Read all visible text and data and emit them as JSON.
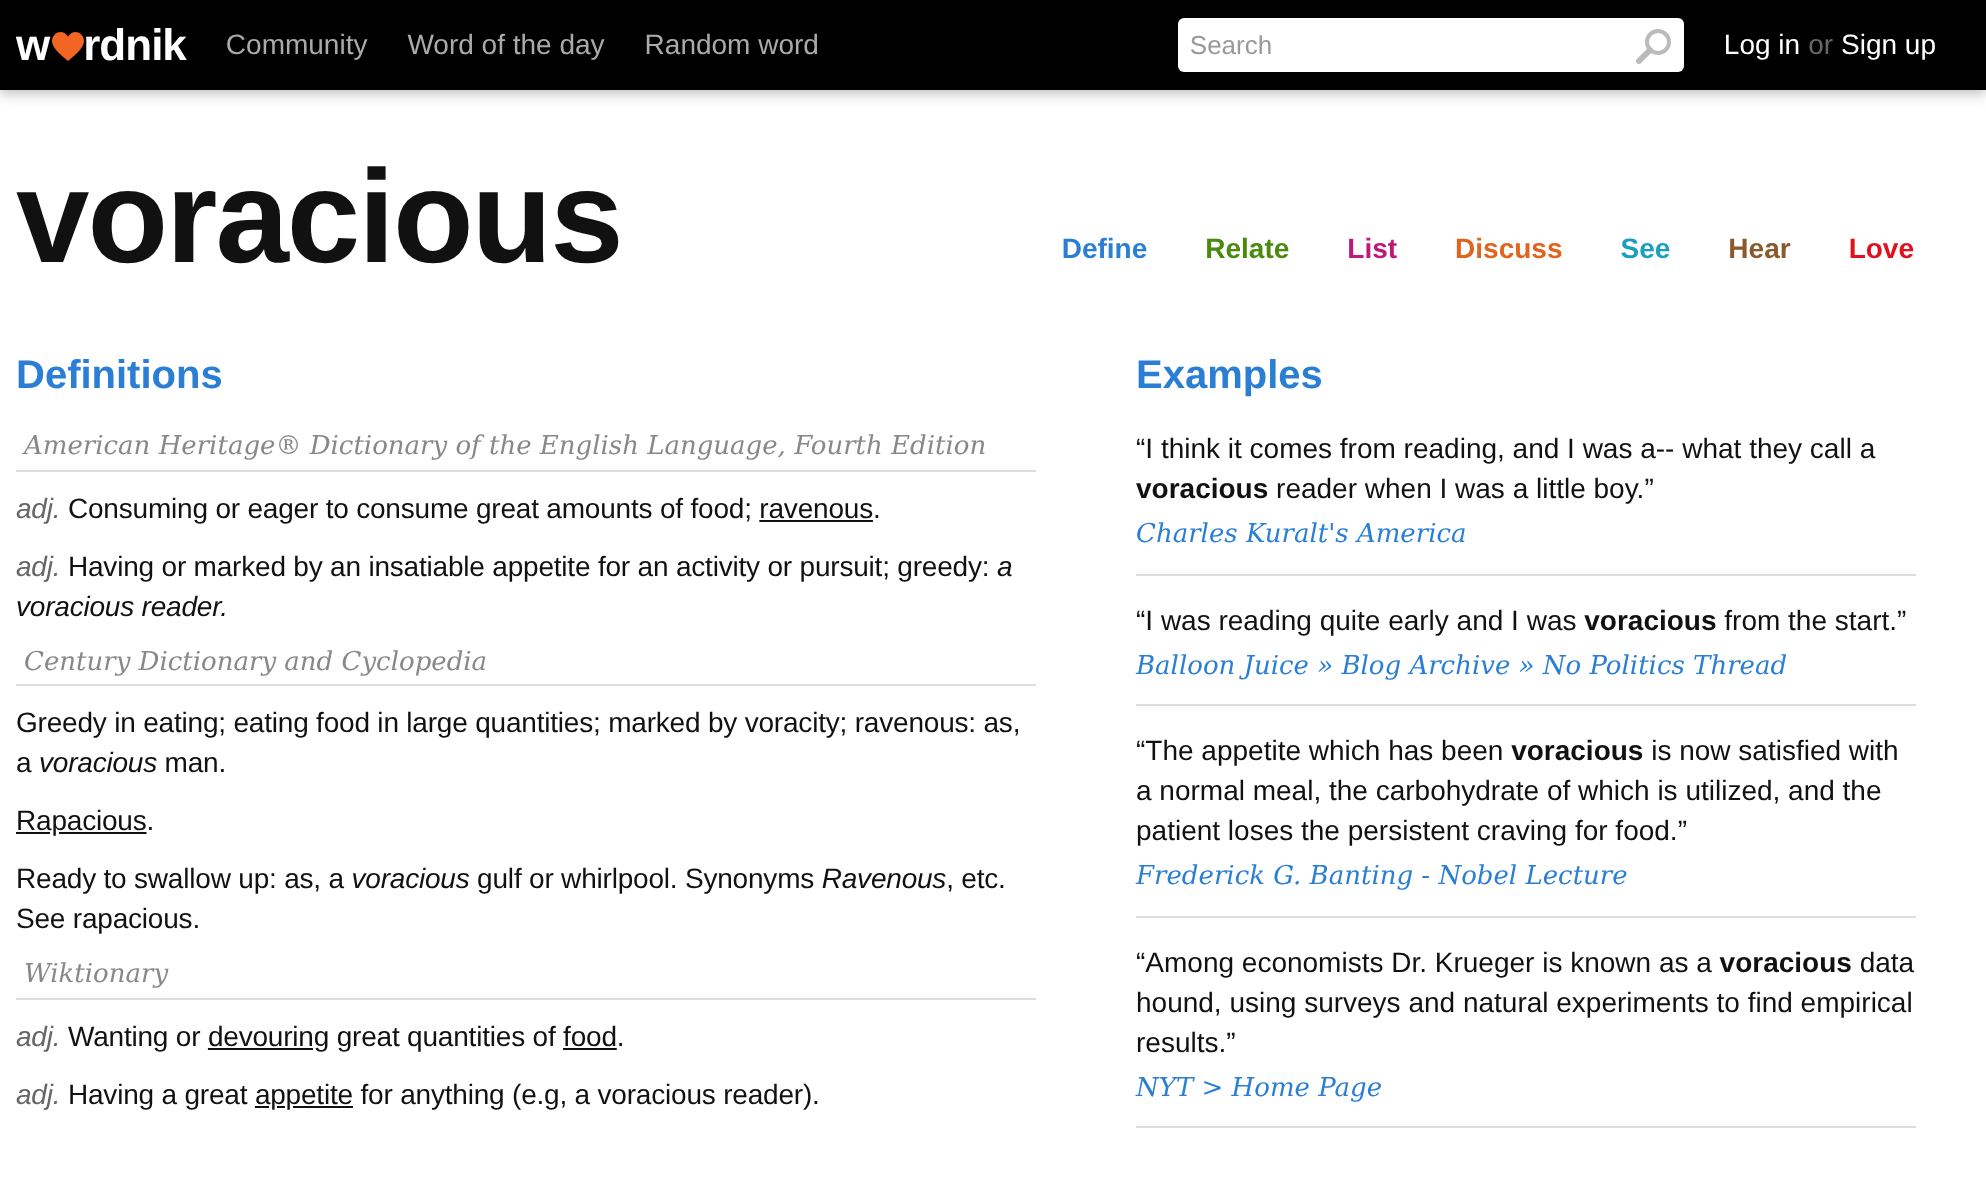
{
  "header": {
    "logo": {
      "before": "w",
      "after": "rdnik"
    },
    "nav": [
      "Community",
      "Word of the day",
      "Random word"
    ],
    "search": {
      "placeholder": "Search"
    },
    "login": "Log in",
    "or": "or",
    "signup": "Sign up"
  },
  "word": "voracious",
  "tabs": [
    {
      "label": "Define",
      "color": "#2a7fd4"
    },
    {
      "label": "Relate",
      "color": "#4a8a0e"
    },
    {
      "label": "List",
      "color": "#c0187a"
    },
    {
      "label": "Discuss",
      "color": "#e0641e"
    },
    {
      "label": "See",
      "color": "#1a9fc0"
    },
    {
      "label": "Hear",
      "color": "#8a5a2a"
    },
    {
      "label": "Love",
      "color": "#e0101e"
    }
  ],
  "definitions": {
    "title": "Definitions",
    "sources": [
      {
        "name": "American Heritage® Dictionary of the English Language, Fourth Edition",
        "entries": [
          {
            "pos": "adj.",
            "segments": [
              {
                "kind": "text",
                "text": "Consuming or eager to consume great amounts of food; "
              },
              {
                "kind": "link",
                "text": "ravenous"
              },
              {
                "kind": "text",
                "text": "."
              }
            ]
          },
          {
            "pos": "adj.",
            "segments": [
              {
                "kind": "text",
                "text": "Having or marked by an insatiable appetite for an activity or pursuit; greedy: *a voracious reader.*"
              }
            ]
          }
        ]
      },
      {
        "name": "Century Dictionary and Cyclopedia",
        "entries": [
          {
            "segments": [
              {
                "kind": "text",
                "text": "Greedy in eating; eating food in large quantities; marked by voracity; ravenous: as, a *voracious* man."
              }
            ]
          },
          {
            "segments": [
              {
                "kind": "link",
                "text": "Rapacious"
              },
              {
                "kind": "text",
                "text": "."
              }
            ]
          },
          {
            "segments": [
              {
                "kind": "text",
                "text": "Ready to swallow up: as, a *voracious* gulf or whirlpool. Synonyms *Ravenous*, etc. See rapacious."
              }
            ]
          }
        ]
      },
      {
        "name": "Wiktionary",
        "entries": [
          {
            "pos": "adj.",
            "segments": [
              {
                "kind": "text",
                "text": "Wanting or "
              },
              {
                "kind": "link",
                "text": "devouring"
              },
              {
                "kind": "text",
                "text": " great quantities of "
              },
              {
                "kind": "link",
                "text": "food"
              },
              {
                "kind": "text",
                "text": "."
              }
            ]
          },
          {
            "pos": "adj.",
            "segments": [
              {
                "kind": "text",
                "text": "Having a great "
              },
              {
                "kind": "link",
                "text": "appetite"
              },
              {
                "kind": "text",
                "text": " for anything (e.g, a voracious reader)."
              }
            ]
          }
        ]
      }
    ]
  },
  "examples": {
    "title": "Examples",
    "items": [
      {
        "quote": "“I think it comes from reading, and I was a-- what they call a **voracious** reader when I was a little boy.”",
        "source": "Charles Kuralt's America"
      },
      {
        "quote": "“I was reading quite early and I was **voracious** from the start.”",
        "source": "Balloon Juice » Blog Archive » No Politics Thread"
      },
      {
        "quote": "“The appetite which has been **voracious** is now satisfied with a normal meal, the carbohydrate of which is utilized, and the patient loses the persistent craving for food.”",
        "source": "Frederick G. Banting - Nobel Lecture"
      },
      {
        "quote": "“Among economists Dr. Krueger is known as a **voracious** data hound, using surveys and natural experiments to find empirical results.”",
        "source": "NYT > Home Page"
      }
    ]
  }
}
